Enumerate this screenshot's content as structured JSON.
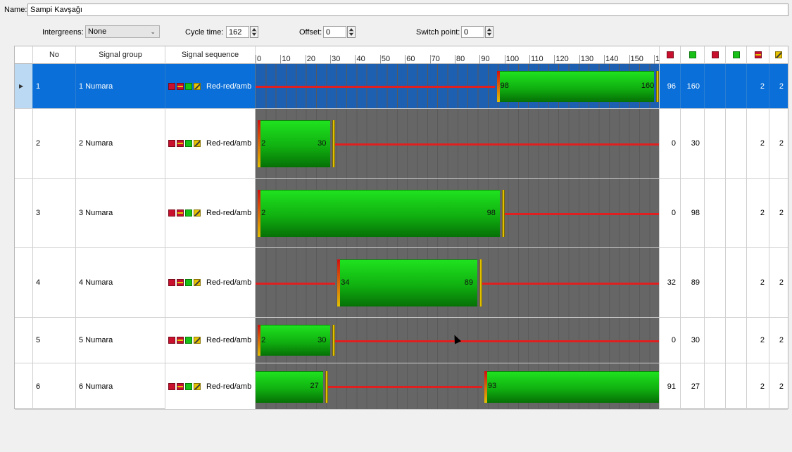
{
  "form": {
    "name_label": "Name:",
    "name_value": "Sampi Kavşağı",
    "intergreens_label": "Intergreens:",
    "intergreens_value": "None",
    "cycle_label": "Cycle time:",
    "cycle_value": "162",
    "offset_label": "Offset:",
    "offset_value": "0",
    "switch_label": "Switch point:",
    "switch_value": "0"
  },
  "columns": {
    "no": "No",
    "signal_group": "Signal group",
    "signal_sequence": "Signal sequence"
  },
  "ticks": [
    "0",
    "10",
    "20",
    "30",
    "40",
    "50",
    "60",
    "70",
    "80",
    "90",
    "100",
    "110",
    "120",
    "130",
    "140",
    "150",
    "1"
  ],
  "header_icons": [
    "red-end-icon",
    "green-end-icon",
    "red-icon",
    "green-icon",
    "red-amber-icon",
    "amber-icon"
  ],
  "rows": [
    {
      "no": "1",
      "name": "1 Numara",
      "sequence": "Red-red/amb",
      "green_start": 98,
      "green_end": 160,
      "col_red": "96",
      "col_green": "160",
      "col_ra": "2",
      "col_amb": "2",
      "selected": true
    },
    {
      "no": "2",
      "name": "2 Numara",
      "sequence": "Red-red/amb",
      "green_start": 2,
      "green_end": 30,
      "col_red": "0",
      "col_green": "30",
      "col_ra": "2",
      "col_amb": "2",
      "selected": false
    },
    {
      "no": "3",
      "name": "3 Numara",
      "sequence": "Red-red/amb",
      "green_start": 2,
      "green_end": 98,
      "col_red": "0",
      "col_green": "98",
      "col_ra": "2",
      "col_amb": "2",
      "selected": false
    },
    {
      "no": "4",
      "name": "4 Numara",
      "sequence": "Red-red/amb",
      "green_start": 34,
      "green_end": 89,
      "col_red": "32",
      "col_green": "89",
      "col_ra": "2",
      "col_amb": "2",
      "selected": false
    },
    {
      "no": "5",
      "name": "5 Numara",
      "sequence": "Red-red/amb",
      "green_start": 2,
      "green_end": 30,
      "col_red": "0",
      "col_green": "30",
      "col_ra": "2",
      "col_amb": "2",
      "selected": false
    },
    {
      "no": "6",
      "name": "6 Numara",
      "sequence": "Red-red/amb",
      "green_start": 93,
      "green_end": 27,
      "col_red": "91",
      "col_green": "27",
      "col_ra": "2",
      "col_amb": "2",
      "selected": false
    }
  ],
  "colors": {
    "selection": "#0a6fd8",
    "green": "#18c018",
    "red": "#e02020",
    "amber": "#e0c000"
  }
}
